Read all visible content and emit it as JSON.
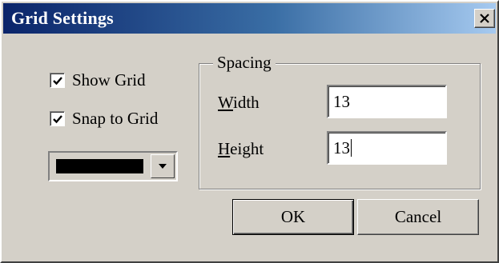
{
  "window": {
    "title": "Grid Settings",
    "close_glyph": "✕"
  },
  "options": {
    "show_grid": {
      "label": "Show Grid",
      "checked": true
    },
    "snap_to_grid": {
      "label": "Snap to Grid",
      "checked": true
    }
  },
  "color_picker": {
    "selected_color": "#000000",
    "dropdown_icon": "triangle-down"
  },
  "spacing": {
    "group_title": "Spacing",
    "width": {
      "label": "Width",
      "accelerator": "W",
      "value": "13"
    },
    "height": {
      "label": "Height",
      "accelerator": "H",
      "value": "13"
    }
  },
  "buttons": {
    "ok": "OK",
    "cancel": "Cancel"
  },
  "colors": {
    "dialog_bg": "#d4d0c8",
    "title_gradient_start": "#0a246a",
    "title_gradient_end": "#a6caf0"
  }
}
